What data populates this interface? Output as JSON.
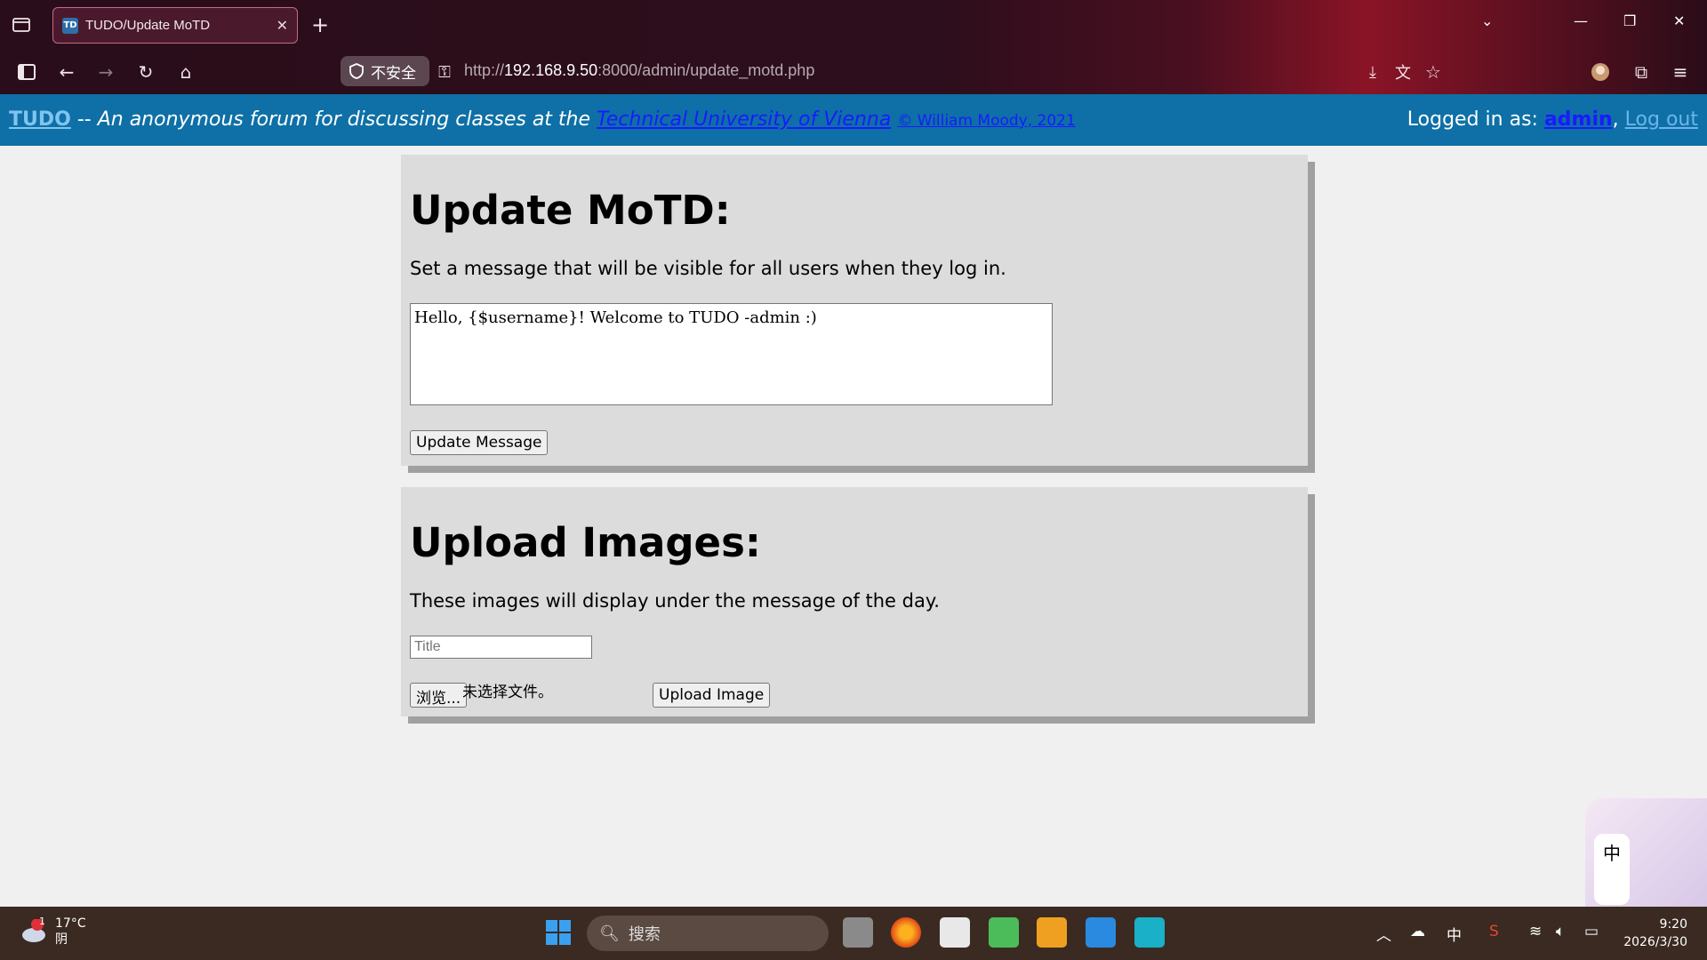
{
  "browser": {
    "tab_title": "TUDO/Update MoTD",
    "tab_favicon": "TD",
    "new_tab": "+",
    "security_label": "不安全",
    "url_prefix": "http://",
    "url_host": "192.168.9.50",
    "url_rest": ":8000/admin/update_motd.php"
  },
  "site": {
    "brand": "TUDO",
    "separator": " -- ",
    "tagline": "An anonymous forum for discussing classes at the ",
    "university": "Technical University of Vienna",
    "copyright": "© William Moody, 2021",
    "logged_in_label": "Logged in as: ",
    "username": "admin",
    "comma": ", ",
    "logout": "Log out"
  },
  "motd_panel": {
    "heading": "Update MoTD:",
    "description": "Set a message that will be visible for all users when they log in.",
    "message_value": "Hello, {$username}! Welcome to TUDO -admin :)",
    "button": "Update Message"
  },
  "upload_panel": {
    "heading": "Upload Images:",
    "description": "These images will display under the message of the day.",
    "title_placeholder": "Title",
    "browse_button": "浏览...",
    "no_file_text": "未选择文件。",
    "upload_button": "Upload Image"
  },
  "ime": {
    "mode": "中"
  },
  "taskbar": {
    "weather_badge": "1",
    "temperature": "17°C",
    "condition": "阴",
    "search_label": "搜索",
    "input_lang": "中",
    "time": "9:20",
    "date": "2026/3/30"
  },
  "colors": {
    "header_bg": "#0e70a6",
    "panel_bg": "#dcdcdc",
    "page_bg": "#f0f0f0"
  }
}
